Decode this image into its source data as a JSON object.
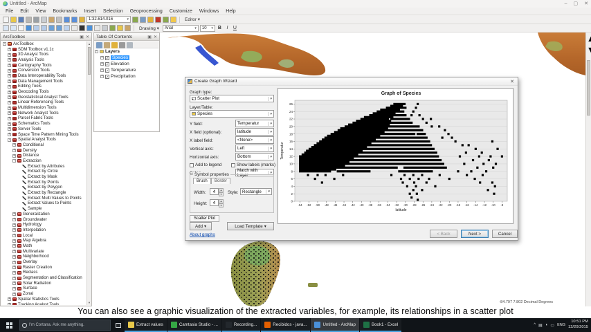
{
  "window": {
    "title": "Untitled - ArcMap",
    "minimize": "–",
    "maximize": "▢",
    "close": "✕"
  },
  "menu_bar": {
    "items": [
      "File",
      "Edit",
      "View",
      "Bookmarks",
      "Insert",
      "Selection",
      "Geoprocessing",
      "Customize",
      "Windows",
      "Help"
    ]
  },
  "toolbar": {
    "scale_value": "1:32.614.016",
    "editor_label": "Editor",
    "editor_arrow": "▾",
    "drawing_label": "Drawing",
    "drawing_arrow": "▾",
    "font_name": "Arial",
    "font_size": "10",
    "bold": "B",
    "italic": "I",
    "underline": "U",
    "row1_icons": [
      "new-document",
      "open-folder",
      "save",
      "print",
      "cut",
      "copy",
      "paste",
      "delete",
      "undo",
      "redo",
      "add-data",
      "go",
      "viewer",
      "catalog",
      "toolbox",
      "model-builder",
      "python"
    ],
    "row2_icons": [
      "zoom-in",
      "zoom-out",
      "pan",
      "full-extent",
      "fixed-zoom-in",
      "fixed-zoom-out",
      "back-extent",
      "forward-extent",
      "select-features",
      "clear-selection",
      "select-elements",
      "identify",
      "find",
      "go-to-xy",
      "measure",
      "hyperlink",
      "html-popup"
    ]
  },
  "arctoolbox": {
    "title": "ArcToolbox",
    "tree": [
      {
        "lvl": 0,
        "exp": "-",
        "kind": "root",
        "label": "ArcToolbox"
      },
      {
        "lvl": 1,
        "exp": "+",
        "kind": "box",
        "label": "SDM Toolbox v1.1c"
      },
      {
        "lvl": 1,
        "exp": "+",
        "kind": "box",
        "label": "3D Analyst Tools"
      },
      {
        "lvl": 1,
        "exp": "+",
        "kind": "box",
        "label": "Analysis Tools"
      },
      {
        "lvl": 1,
        "exp": "+",
        "kind": "box",
        "label": "Cartography Tools"
      },
      {
        "lvl": 1,
        "exp": "+",
        "kind": "box",
        "label": "Conversion Tools"
      },
      {
        "lvl": 1,
        "exp": "+",
        "kind": "box",
        "label": "Data Interoperability Tools"
      },
      {
        "lvl": 1,
        "exp": "+",
        "kind": "box",
        "label": "Data Management Tools"
      },
      {
        "lvl": 1,
        "exp": "+",
        "kind": "box",
        "label": "Editing Tools"
      },
      {
        "lvl": 1,
        "exp": "+",
        "kind": "box",
        "label": "Geocoding Tools"
      },
      {
        "lvl": 1,
        "exp": "+",
        "kind": "box",
        "label": "Geostatistical Analyst Tools"
      },
      {
        "lvl": 1,
        "exp": "+",
        "kind": "box",
        "label": "Linear Referencing Tools"
      },
      {
        "lvl": 1,
        "exp": "+",
        "kind": "box",
        "label": "Multidimension Tools"
      },
      {
        "lvl": 1,
        "exp": "+",
        "kind": "box",
        "label": "Network Analyst Tools"
      },
      {
        "lvl": 1,
        "exp": "+",
        "kind": "box",
        "label": "Parcel Fabric Tools"
      },
      {
        "lvl": 1,
        "exp": "+",
        "kind": "box",
        "label": "Schematics Tools"
      },
      {
        "lvl": 1,
        "exp": "+",
        "kind": "box",
        "label": "Server Tools"
      },
      {
        "lvl": 1,
        "exp": "+",
        "kind": "box",
        "label": "Space Time Pattern Mining Tools"
      },
      {
        "lvl": 1,
        "exp": "-",
        "kind": "box",
        "label": "Spatial Analyst Tools"
      },
      {
        "lvl": 2,
        "exp": "+",
        "kind": "set",
        "label": "Conditional"
      },
      {
        "lvl": 2,
        "exp": "+",
        "kind": "set",
        "label": "Density"
      },
      {
        "lvl": 2,
        "exp": "+",
        "kind": "set",
        "label": "Distance"
      },
      {
        "lvl": 2,
        "exp": "-",
        "kind": "set",
        "label": "Extraction"
      },
      {
        "lvl": 3,
        "exp": "",
        "kind": "tool",
        "label": "Extract by Attributes"
      },
      {
        "lvl": 3,
        "exp": "",
        "kind": "tool",
        "label": "Extract by Circle"
      },
      {
        "lvl": 3,
        "exp": "",
        "kind": "tool",
        "label": "Extract by Mask"
      },
      {
        "lvl": 3,
        "exp": "",
        "kind": "tool",
        "label": "Extract by Points"
      },
      {
        "lvl": 3,
        "exp": "",
        "kind": "tool",
        "label": "Extract by Polygon"
      },
      {
        "lvl": 3,
        "exp": "",
        "kind": "tool",
        "label": "Extract by Rectangle"
      },
      {
        "lvl": 3,
        "exp": "",
        "kind": "tool",
        "label": "Extract Multi Values to Points"
      },
      {
        "lvl": 3,
        "exp": "",
        "kind": "tool",
        "label": "Extract Values to Points"
      },
      {
        "lvl": 3,
        "exp": "",
        "kind": "tool",
        "label": "Sample"
      },
      {
        "lvl": 2,
        "exp": "+",
        "kind": "set",
        "label": "Generalization"
      },
      {
        "lvl": 2,
        "exp": "+",
        "kind": "set",
        "label": "Groundwater"
      },
      {
        "lvl": 2,
        "exp": "+",
        "kind": "set",
        "label": "Hydrology"
      },
      {
        "lvl": 2,
        "exp": "+",
        "kind": "set",
        "label": "Interpolation"
      },
      {
        "lvl": 2,
        "exp": "+",
        "kind": "set",
        "label": "Local"
      },
      {
        "lvl": 2,
        "exp": "+",
        "kind": "set",
        "label": "Map Algebra"
      },
      {
        "lvl": 2,
        "exp": "+",
        "kind": "set",
        "label": "Math"
      },
      {
        "lvl": 2,
        "exp": "+",
        "kind": "set",
        "label": "Multivariate"
      },
      {
        "lvl": 2,
        "exp": "+",
        "kind": "set",
        "label": "Neighborhood"
      },
      {
        "lvl": 2,
        "exp": "+",
        "kind": "set",
        "label": "Overlay"
      },
      {
        "lvl": 2,
        "exp": "+",
        "kind": "set",
        "label": "Raster Creation"
      },
      {
        "lvl": 2,
        "exp": "+",
        "kind": "set",
        "label": "Reclass"
      },
      {
        "lvl": 2,
        "exp": "+",
        "kind": "set",
        "label": "Segmentation and Classification"
      },
      {
        "lvl": 2,
        "exp": "+",
        "kind": "set",
        "label": "Solar Radiation"
      },
      {
        "lvl": 2,
        "exp": "+",
        "kind": "set",
        "label": "Surface"
      },
      {
        "lvl": 2,
        "exp": "+",
        "kind": "set",
        "label": "Zonal"
      },
      {
        "lvl": 1,
        "exp": "+",
        "kind": "box",
        "label": "Spatial Statistics Tools"
      },
      {
        "lvl": 1,
        "exp": "+",
        "kind": "box",
        "label": "Tracking Analyst Tools"
      }
    ]
  },
  "toc": {
    "title": "Table Of Contents",
    "root": "Layers",
    "layers": [
      {
        "label": "Species",
        "selected": true
      },
      {
        "label": "Elevation",
        "selected": false
      },
      {
        "label": "Temperature",
        "selected": false
      },
      {
        "label": "Precipitation",
        "selected": false
      }
    ]
  },
  "dialog": {
    "title": "Create Graph Wizard",
    "close": "✕",
    "fields": {
      "graph_type": {
        "label": "Graph type:",
        "value": "Scatter Plot"
      },
      "layer_table": {
        "label": "Layer/Table:",
        "value": "Species"
      },
      "y_field": {
        "label": "Y field:",
        "value": "Temperatur"
      },
      "x_field": {
        "label": "X field (optional):",
        "value": "latitude"
      },
      "x_label_field": {
        "label": "X label field:",
        "value": "<None>"
      },
      "vertical_axis": {
        "label": "Vertical axis:",
        "value": "Left"
      },
      "horizontal_axis": {
        "label": "Horizontal axis:",
        "value": "Bottom"
      },
      "color": {
        "label": "Color:",
        "value": "Match with Layer"
      }
    },
    "checkboxes": {
      "add_to_legend": {
        "label": "Add to legend",
        "checked": false
      },
      "show_labels": {
        "label": "Show labels (marks)",
        "checked": false
      }
    },
    "symbol": {
      "group_label": "Symbol properties",
      "tab_brush": "Brush",
      "tab_border": "Border",
      "width_label": "Width:",
      "width_value": "4",
      "style_label": "Style:",
      "style_value": "Rectangle",
      "height_label": "Height:",
      "height_value": "4"
    },
    "footer_tab": "Scatter Plot",
    "add_button": "Add",
    "add_arrow": "▾",
    "load_template_button": "Load Template",
    "load_arrow": "▾",
    "about_link": "About graphs",
    "buttons": {
      "back": "< Back",
      "next": "Next >",
      "cancel": "Cancel"
    }
  },
  "chart_data": {
    "type": "scatter",
    "title": "Graph of Species",
    "xlabel": "latitude",
    "ylabel": "Temperatur",
    "xlim": [
      -55.2,
      -6.8
    ],
    "ylim": [
      0,
      27
    ],
    "x_ticks": [
      -54,
      -52,
      -50,
      -48,
      -46,
      -44,
      -42,
      -40,
      -38,
      -36,
      -34,
      -32,
      -30,
      -28,
      -26,
      -24,
      -22,
      -20,
      -18,
      -16,
      -14,
      -12,
      -10,
      -8
    ],
    "y_ticks": [
      0,
      2,
      4,
      6,
      8,
      10,
      12,
      14,
      16,
      18,
      20,
      22,
      24,
      26
    ],
    "marker": {
      "shape": "square",
      "color": "#000000"
    },
    "grid": true,
    "plot_bg": "#e9e9e9",
    "rows": [
      {
        "y": 26,
        "segments": [
          [
            -32.5,
            -30.2
          ]
        ],
        "dots": [
          -27.2
        ]
      },
      {
        "y": 25.5,
        "segments": [
          [
            -33.2,
            -30.8
          ]
        ],
        "dots": []
      },
      {
        "y": 25,
        "segments": [
          [
            -34.2,
            -30.0
          ]
        ],
        "dots": [
          -27.6
        ]
      },
      {
        "y": 24.5,
        "segments": [
          [
            -35.5,
            -31.5
          ]
        ],
        "dots": []
      },
      {
        "y": 24,
        "segments": [
          [
            -36.3,
            -30.5
          ]
        ],
        "dots": [
          -28.2
        ]
      },
      {
        "y": 23.5,
        "segments": [
          [
            -37.2,
            -32.5
          ]
        ],
        "dots": []
      },
      {
        "y": 23,
        "segments": [
          [
            -38.0,
            -30.0
          ]
        ],
        "dots": [
          -28.6,
          -26.8
        ]
      },
      {
        "y": 22.5,
        "segments": [
          [
            -39.2,
            -33.0
          ]
        ],
        "dots": []
      },
      {
        "y": 22,
        "segments": [
          [
            -40.0,
            -34.0
          ],
          [
            -33.2,
            -29.2
          ]
        ],
        "dots": [
          -26.0,
          -24.2
        ]
      },
      {
        "y": 21.5,
        "segments": [
          [
            -41.0,
            -33.5
          ]
        ],
        "dots": []
      },
      {
        "y": 21,
        "segments": [
          [
            -41.8,
            -28.6
          ]
        ],
        "dots": [
          -25.2
        ]
      },
      {
        "y": 20.5,
        "segments": [
          [
            -42.8,
            -33.8
          ]
        ],
        "dots": []
      },
      {
        "y": 20,
        "segments": [
          [
            -43.6,
            -27.0
          ]
        ],
        "dots": [
          -24.0,
          -22.3
        ]
      },
      {
        "y": 19.5,
        "segments": [
          [
            -44.6,
            -34.2
          ]
        ],
        "dots": []
      },
      {
        "y": 19,
        "segments": [
          [
            -45.2,
            -26.2
          ]
        ],
        "dots": [
          -21.0
        ]
      },
      {
        "y": 18.5,
        "segments": [
          [
            -46.0,
            -35.0
          ]
        ],
        "dots": []
      },
      {
        "y": 18,
        "segments": [
          [
            -46.8,
            -28.0
          ],
          [
            -27.2,
            -25.6
          ]
        ],
        "dots": [
          -20.2
        ]
      },
      {
        "y": 17.5,
        "segments": [
          [
            -47.6,
            -36.0
          ]
        ],
        "dots": []
      },
      {
        "y": 17,
        "segments": [
          [
            -48.2,
            -25.2
          ]
        ],
        "dots": [
          -21.6,
          -19.4
        ]
      },
      {
        "y": 16.5,
        "segments": [
          [
            -48.8,
            -37.0
          ]
        ],
        "dots": []
      },
      {
        "y": 16,
        "segments": [
          [
            -49.4,
            -24.6
          ]
        ],
        "dots": [
          -18.6,
          -10.2
        ]
      },
      {
        "y": 15.5,
        "segments": [
          [
            -50.0,
            -38.0
          ]
        ],
        "dots": []
      },
      {
        "y": 15,
        "segments": [
          [
            -50.6,
            -24.2
          ]
        ],
        "dots": [
          -17.0,
          -15.6
        ]
      },
      {
        "y": 14.5,
        "segments": [
          [
            -51.2,
            -39.0
          ]
        ],
        "dots": []
      },
      {
        "y": 14,
        "segments": [
          [
            -51.8,
            -23.6
          ]
        ],
        "dots": [
          -14.0,
          -9.0
        ]
      },
      {
        "y": 13.5,
        "segments": [
          [
            -52.4,
            -40.0
          ]
        ],
        "dots": []
      },
      {
        "y": 13,
        "segments": [
          [
            -52.8,
            -23.0
          ]
        ],
        "dots": [
          -16.2,
          -12.6
        ]
      },
      {
        "y": 12.5,
        "segments": [
          [
            -53.4,
            -41.0
          ]
        ],
        "dots": []
      },
      {
        "y": 12,
        "segments": [
          [
            -54.0,
            -22.6
          ]
        ],
        "dots": [
          -17.6,
          -13.2,
          -10.6,
          -8.0
        ]
      },
      {
        "y": 11.5,
        "segments": [
          [
            -54.0,
            -42.0
          ]
        ],
        "dots": []
      },
      {
        "y": 11,
        "segments": [
          [
            -54.0,
            -22.0
          ]
        ],
        "dots": [
          -14.6,
          -11.0
        ]
      },
      {
        "y": 10.5,
        "segments": [
          [
            -54.0,
            -43.0
          ]
        ],
        "dots": []
      },
      {
        "y": 10,
        "segments": [
          [
            -54.0,
            -21.4
          ]
        ],
        "dots": [
          -16.6,
          -12.2,
          -9.4
        ]
      },
      {
        "y": 9.5,
        "segments": [
          [
            -54.0,
            -44.0
          ]
        ],
        "dots": []
      },
      {
        "y": 9,
        "segments": [
          [
            -54.0,
            -32.0
          ],
          [
            -30.2,
            -20.8
          ]
        ],
        "dots": [
          -13.6,
          -10.0
        ]
      },
      {
        "y": 8.5,
        "segments": [
          [
            -54.0,
            -46.0
          ]
        ],
        "dots": []
      },
      {
        "y": 8,
        "segments": [
          [
            -54.0,
            -47.2
          ],
          [
            -45.4,
            -38.2
          ],
          [
            -31.4,
            -24.0
          ]
        ],
        "dots": [
          -18.0,
          -15.0,
          -11.6
        ]
      },
      {
        "y": 7,
        "segments": [],
        "dots": [
          -52.2,
          -50.0,
          -48.2,
          -44.2,
          -33.2,
          -30.2,
          -28.2,
          -26.2,
          -22.2,
          -16.0,
          -12.4
        ]
      },
      {
        "y": 6,
        "segments": [],
        "dots": [
          -50.6,
          -46.2,
          -31.0,
          -29.0,
          -27.0,
          -24.6,
          -20.0,
          -14.2
        ]
      },
      {
        "y": 5,
        "segments": [],
        "dots": [
          -49.0,
          -30.6,
          -28.0,
          -25.2,
          -13.0,
          -10.2
        ]
      },
      {
        "y": 4,
        "segments": [],
        "dots": [
          -29.6,
          -27.6,
          -23.2,
          -9.6
        ]
      },
      {
        "y": 3,
        "segments": [],
        "dots": [
          -28.2,
          -26.2,
          -11.2
        ]
      },
      {
        "y": 2,
        "segments": [],
        "dots": [
          -29.0,
          -27.4,
          -9.8
        ]
      },
      {
        "y": 1,
        "segments": [],
        "dots": [
          -28.6
        ]
      },
      {
        "y": 0.4,
        "segments": [],
        "dots": [
          -27.2
        ]
      }
    ]
  },
  "caption": "You can also see a graphic visualization of the extracted variables, for example, its relationships in a scatter plot",
  "status_bar": {
    "coordinates": "-84.797  7.802 Decimal Degrees"
  },
  "taskbar": {
    "search_placeholder": "I'm Cortana. Ask me anything.",
    "items": [
      {
        "label": "Extract values",
        "icon": "notepad",
        "color": "#e8c84a",
        "active": false
      },
      {
        "label": "Camtasia Studio - ...",
        "icon": "camtasia",
        "color": "#35a845",
        "active": false
      },
      {
        "label": "Recording...",
        "icon": "camtasia-recorder",
        "color": "#23282d",
        "active": false
      },
      {
        "label": "Recibidos - java...",
        "icon": "firefox",
        "color": "#e66000",
        "active": false
      },
      {
        "label": "Untitled - ArcMap",
        "icon": "arcmap",
        "color": "#4a90d9",
        "active": true
      },
      {
        "label": "Book1 - Excel",
        "icon": "excel",
        "color": "#1e7145",
        "active": false
      }
    ],
    "tray": {
      "chevron": "^",
      "lang": "ENG",
      "time": "10:51 PM",
      "date": "12/20/2015"
    }
  }
}
